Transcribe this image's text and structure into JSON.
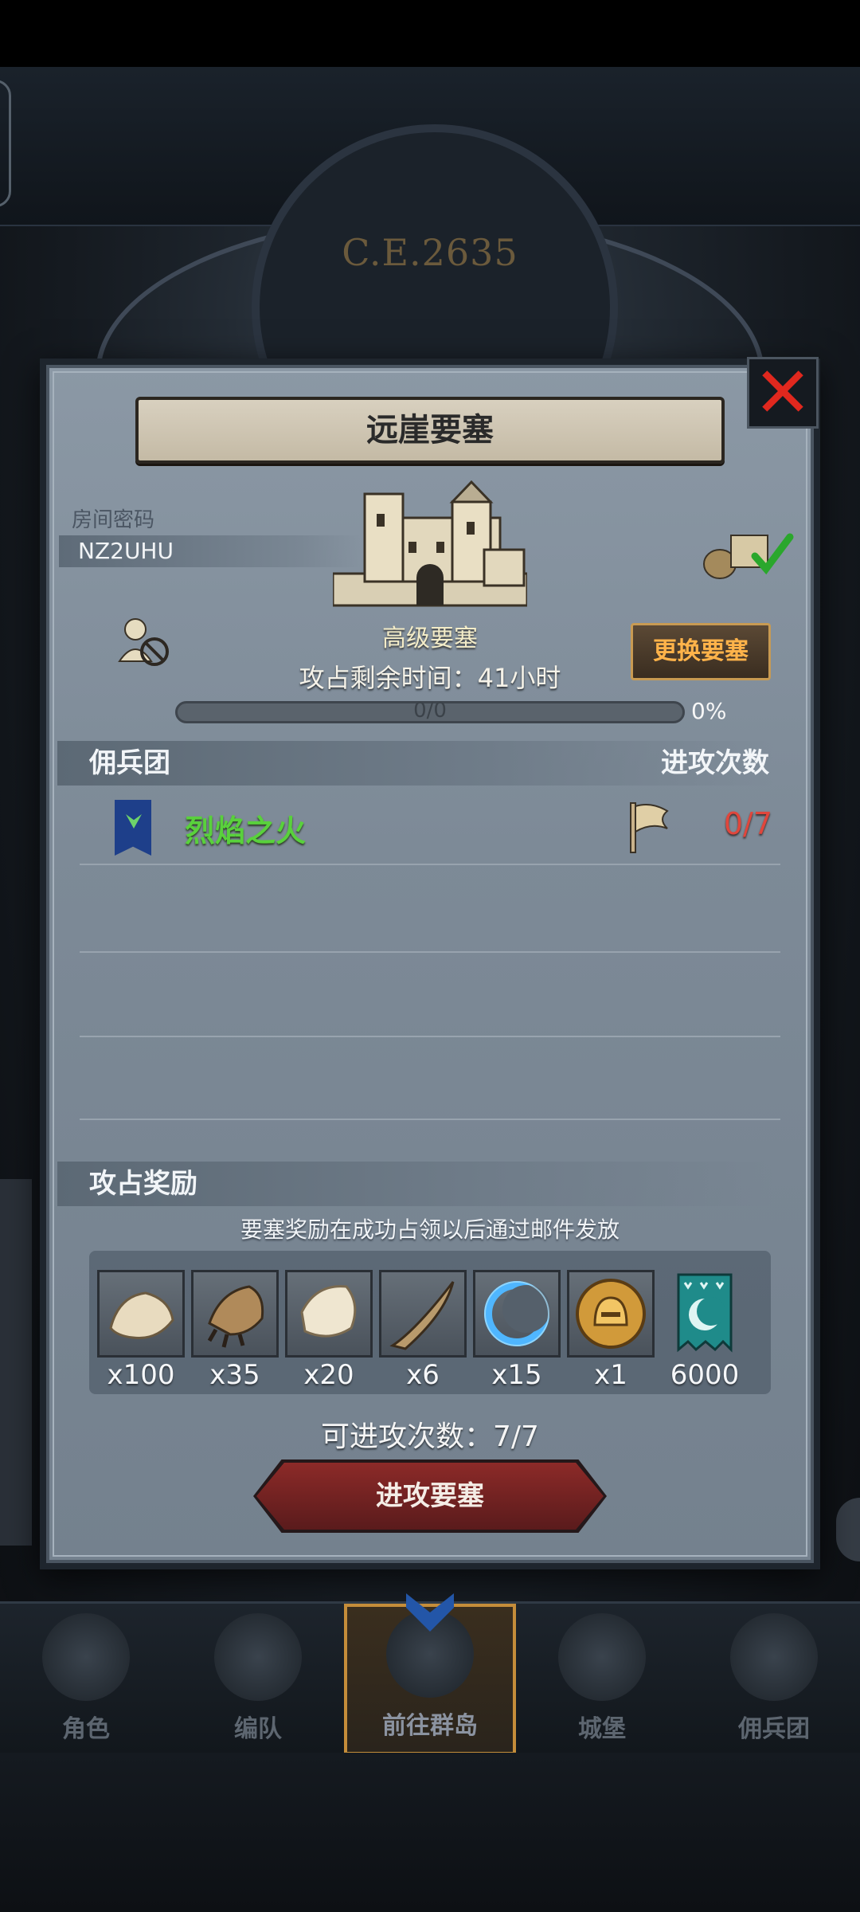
{
  "header": {
    "era": "C.E.2635"
  },
  "modal": {
    "title": "远崖要塞",
    "room_label": "房间密码",
    "room_code": "NZ2UHU",
    "fort_type": "高级要塞",
    "change_button": "更换要塞",
    "time_left": "攻占剩余时间：41小时",
    "progress": {
      "count": "0/0",
      "percent": "0%",
      "fraction": 0
    },
    "mercenary_header": "佣兵团",
    "attack_count_header": "进攻次数",
    "guild": {
      "name": "烈焰之火",
      "attack_count": "0/7"
    },
    "rewards_header": "攻占奖励",
    "rewards_notice": "要塞奖励在成功占领以后通过邮件发放",
    "rewards": [
      {
        "icon": "fur-pelt-icon",
        "qty": "x100"
      },
      {
        "icon": "beast-claw-icon",
        "qty": "x35"
      },
      {
        "icon": "white-hide-icon",
        "qty": "x20"
      },
      {
        "icon": "horn-icon",
        "qty": "x6"
      },
      {
        "icon": "blue-crescent-gem-icon",
        "qty": "x15"
      },
      {
        "icon": "golden-helmet-coin-icon",
        "qty": "x1"
      },
      {
        "icon": "guild-banner-currency-icon",
        "qty": "6000"
      }
    ],
    "remaining_attacks": "可进攻次数：7/7",
    "attack_button": "进攻要塞"
  },
  "nav": [
    {
      "label": "角色"
    },
    {
      "label": "编队"
    },
    {
      "label": "前往群岛"
    },
    {
      "label": "城堡"
    },
    {
      "label": "佣兵团"
    }
  ],
  "colors": {
    "accent_gold": "#ffb34a",
    "guild_green": "#59d13c",
    "attack_red": "#e0463c"
  }
}
